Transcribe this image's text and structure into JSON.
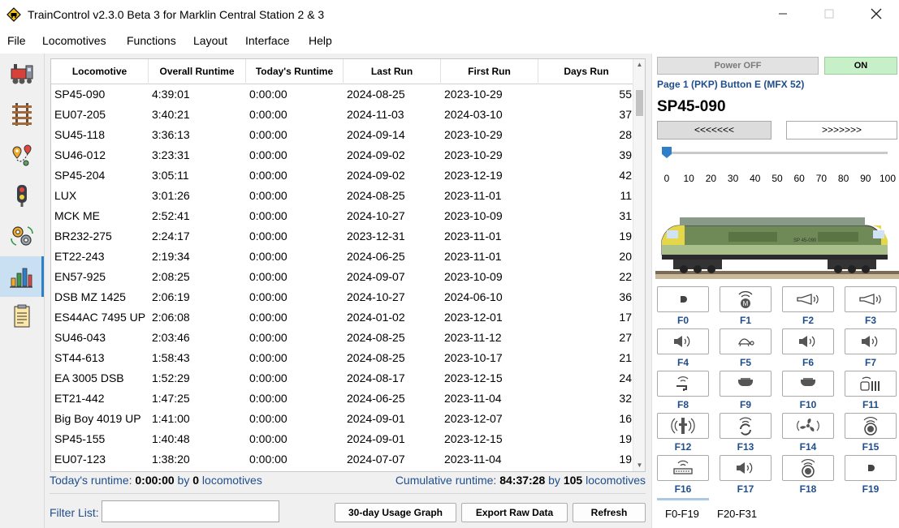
{
  "window": {
    "title": "TrainControl v2.3.0 Beta 3 for Marklin Central Station 2 & 3"
  },
  "menu": [
    "File",
    "Locomotives",
    "Functions",
    "Layout",
    "Interface",
    "Help"
  ],
  "sidebar": {
    "items": [
      {
        "icon": "locomotive-icon"
      },
      {
        "icon": "track-icon"
      },
      {
        "icon": "map-route-icon"
      },
      {
        "icon": "signal-icon"
      },
      {
        "icon": "automation-gears-icon"
      },
      {
        "icon": "stats-chart-icon",
        "active": true
      },
      {
        "icon": "log-notes-icon"
      }
    ]
  },
  "table": {
    "columns": [
      "Locomotive",
      "Overall Runtime",
      "Today's Runtime",
      "Last Run",
      "First Run",
      "Days Run"
    ],
    "rows": [
      [
        "SP45-090",
        "4:39:01",
        "0:00:00",
        "2024-08-25",
        "2023-10-29",
        "55"
      ],
      [
        "EU07-205",
        "3:40:21",
        "0:00:00",
        "2024-11-03",
        "2024-03-10",
        "37"
      ],
      [
        "SU45-118",
        "3:36:13",
        "0:00:00",
        "2024-09-14",
        "2023-10-29",
        "28"
      ],
      [
        "SU46-012",
        "3:23:31",
        "0:00:00",
        "2024-09-02",
        "2023-10-29",
        "39"
      ],
      [
        "SP45-204",
        "3:05:11",
        "0:00:00",
        "2024-09-02",
        "2023-12-19",
        "42"
      ],
      [
        "LUX",
        "3:01:26",
        "0:00:00",
        "2024-08-25",
        "2023-11-01",
        "11"
      ],
      [
        "MCK ME",
        "2:52:41",
        "0:00:00",
        "2024-10-27",
        "2023-10-09",
        "31"
      ],
      [
        "BR232-275",
        "2:24:17",
        "0:00:00",
        "2023-12-31",
        "2023-11-01",
        "19"
      ],
      [
        "ET22-243",
        "2:19:34",
        "0:00:00",
        "2024-06-25",
        "2023-11-01",
        "20"
      ],
      [
        "EN57-925",
        "2:08:25",
        "0:00:00",
        "2024-09-07",
        "2023-10-09",
        "22"
      ],
      [
        "DSB MZ 1425",
        "2:06:19",
        "0:00:00",
        "2024-10-27",
        "2024-06-10",
        "36"
      ],
      [
        "ES44AC 7495 UP",
        "2:06:08",
        "0:00:00",
        "2024-01-02",
        "2023-12-01",
        "17"
      ],
      [
        "SU46-043",
        "2:03:46",
        "0:00:00",
        "2024-08-25",
        "2023-11-12",
        "27"
      ],
      [
        "ST44-613",
        "1:58:43",
        "0:00:00",
        "2024-08-25",
        "2023-10-17",
        "21"
      ],
      [
        "EA 3005 DSB",
        "1:52:29",
        "0:00:00",
        "2024-08-17",
        "2023-12-15",
        "24"
      ],
      [
        "ET21-442",
        "1:47:25",
        "0:00:00",
        "2024-06-25",
        "2023-11-04",
        "32"
      ],
      [
        "Big Boy 4019 UP",
        "1:41:00",
        "0:00:00",
        "2024-09-01",
        "2023-12-07",
        "16"
      ],
      [
        "SP45-155",
        "1:40:48",
        "0:00:00",
        "2024-09-01",
        "2023-12-15",
        "19"
      ],
      [
        "EU07-123",
        "1:38:20",
        "0:00:00",
        "2024-07-07",
        "2023-11-04",
        "19"
      ]
    ]
  },
  "summary": {
    "today_label": "Today's runtime:",
    "today_value": "0:00:00",
    "today_by": "by",
    "today_count": "0",
    "today_unit": "locomotives",
    "cum_label": "Cumulative runtime:",
    "cum_value": "84:37:28",
    "cum_by": "by",
    "cum_count": "105",
    "cum_unit": "locomotives"
  },
  "filter": {
    "label": "Filter List:",
    "value": ""
  },
  "buttons": {
    "graph": "30-day Usage Graph",
    "export": "Export Raw Data",
    "refresh": "Refresh"
  },
  "control": {
    "power_off": "Power OFF",
    "power_on": "ON",
    "page_label": "Page 1 (PKP) Button E (MFX 52)",
    "loco_name": "SP45-090",
    "reverse": "<<<<<<<",
    "forward": ">>>>>>>",
    "speed": 0,
    "ticks": [
      "0",
      "10",
      "20",
      "30",
      "40",
      "50",
      "60",
      "70",
      "80",
      "90",
      "100"
    ],
    "image_text": "SP 45-090",
    "functions": [
      {
        "label": "F0",
        "icon": "headlight-icon"
      },
      {
        "label": "F1",
        "icon": "motor-sound-icon"
      },
      {
        "label": "F2",
        "icon": "horn-icon"
      },
      {
        "label": "F3",
        "icon": "horn-icon"
      },
      {
        "label": "F4",
        "icon": "speaker-icon"
      },
      {
        "label": "F5",
        "icon": "turtle-icon"
      },
      {
        "label": "F6",
        "icon": "speaker-icon"
      },
      {
        "label": "F7",
        "icon": "speaker-icon"
      },
      {
        "label": "F8",
        "icon": "faucet-sound-icon"
      },
      {
        "label": "F9",
        "icon": "cab-light-icon"
      },
      {
        "label": "F10",
        "icon": "cab-light-icon"
      },
      {
        "label": "F11",
        "icon": "passenger-sound-icon"
      },
      {
        "label": "F12",
        "icon": "coupler-sound-icon"
      },
      {
        "label": "F13",
        "icon": "cycle-sound-icon"
      },
      {
        "label": "F14",
        "icon": "fan-icon"
      },
      {
        "label": "F15",
        "icon": "compressor-sound-icon"
      },
      {
        "label": "F16",
        "icon": "brake-sound-icon"
      },
      {
        "label": "F17",
        "icon": "speaker-icon"
      },
      {
        "label": "F18",
        "icon": "compressor-sound-icon"
      },
      {
        "label": "F19",
        "icon": "headlight-icon"
      }
    ],
    "tabs": [
      "F0-F19",
      "F20-F31"
    ]
  }
}
